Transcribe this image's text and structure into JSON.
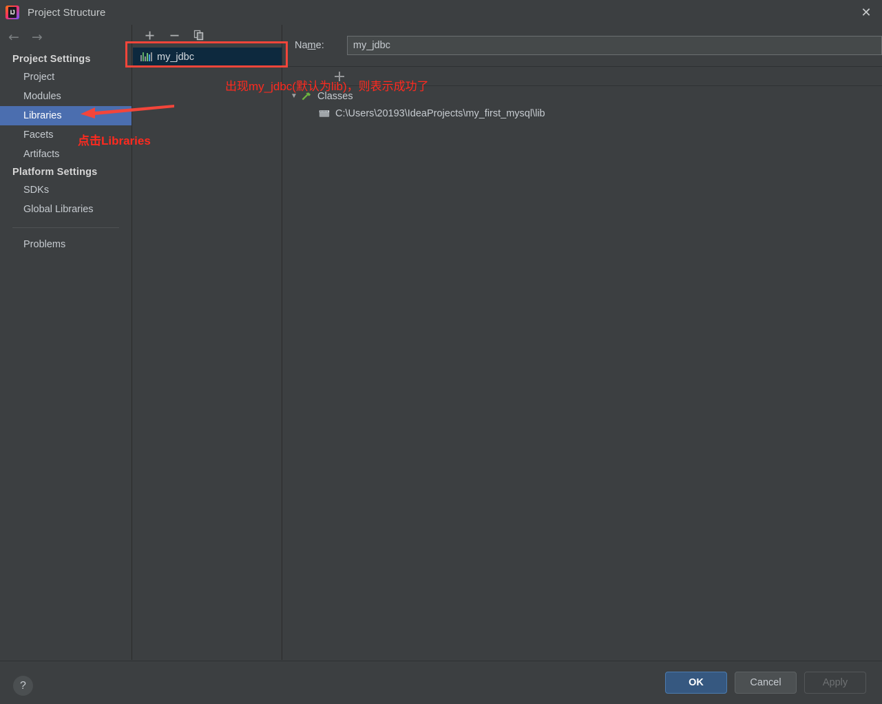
{
  "window": {
    "title": "Project Structure",
    "app_icon": "intellij-idea-logo",
    "close_icon": "✕"
  },
  "navigation": {
    "back_icon": "←",
    "forward_icon": "→"
  },
  "sidebar": {
    "groups": [
      {
        "heading": "Project Settings",
        "items": [
          {
            "label": "Project",
            "selected": false
          },
          {
            "label": "Modules",
            "selected": false
          },
          {
            "label": "Libraries",
            "selected": true
          },
          {
            "label": "Facets",
            "selected": false
          },
          {
            "label": "Artifacts",
            "selected": false
          }
        ]
      },
      {
        "heading": "Platform Settings",
        "items": [
          {
            "label": "SDKs",
            "selected": false
          },
          {
            "label": "Global Libraries",
            "selected": false
          }
        ]
      }
    ],
    "extra": [
      {
        "label": "Problems",
        "selected": false
      }
    ]
  },
  "libraries_panel": {
    "toolbar": [
      {
        "name": "add-library-button",
        "glyph": "+"
      },
      {
        "name": "remove-library-button",
        "glyph": "−"
      },
      {
        "name": "copy-library-button",
        "glyph": "copy-icon"
      }
    ],
    "items": [
      {
        "label": "my_jdbc",
        "icon": "library-bars-icon",
        "selected": true
      }
    ]
  },
  "detail_panel": {
    "name_label_before": "Na",
    "name_label_mnemonic": "m",
    "name_label_after": "e:",
    "name_value": "my_jdbc",
    "name_placeholder": "",
    "toolbar": [
      {
        "name": "add-root-button",
        "glyph": "+"
      }
    ],
    "tree": [
      {
        "label": "Classes",
        "level": 1,
        "twisty": "▼",
        "icon": "classes-hammer-icon",
        "expanded": true
      },
      {
        "label": "C:\\Users\\20193\\IdeaProjects\\my_first_mysql\\lib",
        "level": 2,
        "twisty": "",
        "icon": "folder-icon",
        "expanded": false
      }
    ]
  },
  "annotations": {
    "top_note": "出现my_jdbc(默认为lib)，则表示成功了",
    "side_note": "点击Libraries",
    "color": "#FF2A1F",
    "highlight_color": "#F3453A"
  },
  "bottom_bar": {
    "help_glyph": "?",
    "buttons": [
      {
        "label": "OK",
        "style": "primary",
        "enabled": true
      },
      {
        "label": "Cancel",
        "style": "default",
        "enabled": true
      },
      {
        "label": "Apply",
        "style": "disabled",
        "enabled": false
      }
    ]
  }
}
